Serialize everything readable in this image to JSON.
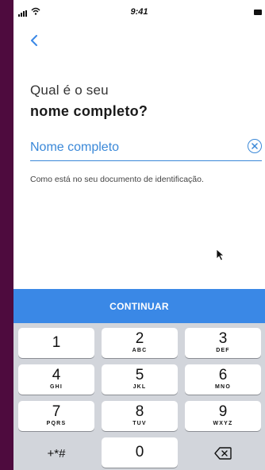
{
  "status_bar": {
    "time": "9:41"
  },
  "nav": {
    "back_icon": "chevron-left-icon"
  },
  "question": {
    "line1": "Qual é o seu",
    "line2": "nome completo?"
  },
  "name_field": {
    "placeholder": "Nome completo",
    "value": "",
    "clear_icon": "clear-circle-icon"
  },
  "helper": {
    "text": "Como está no seu documento de identificação."
  },
  "continue_button": {
    "label": "CONTINUAR"
  },
  "keypad": {
    "keys": [
      {
        "digit": "1",
        "letters": ""
      },
      {
        "digit": "2",
        "letters": "ABC"
      },
      {
        "digit": "3",
        "letters": "DEF"
      },
      {
        "digit": "4",
        "letters": "GHI"
      },
      {
        "digit": "5",
        "letters": "JKL"
      },
      {
        "digit": "6",
        "letters": "MNO"
      },
      {
        "digit": "7",
        "letters": "PQRS"
      },
      {
        "digit": "8",
        "letters": "TUV"
      },
      {
        "digit": "9",
        "letters": "WXYZ"
      },
      {
        "digit": "+*#",
        "letters": ""
      },
      {
        "digit": "0",
        "letters": ""
      },
      {
        "digit": "",
        "letters": ""
      }
    ],
    "delete_icon": "backspace-icon"
  },
  "colors": {
    "accent": "#3a88e6",
    "input_blue": "#3a88d8",
    "frame": "#4e0b3e",
    "keypad_bg": "#d2d5db"
  }
}
